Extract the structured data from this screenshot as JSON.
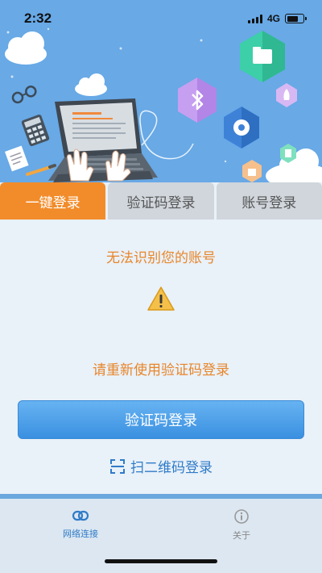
{
  "status": {
    "time": "2:32",
    "network": "4G"
  },
  "tabs": [
    {
      "label": "一键登录",
      "active": true
    },
    {
      "label": "验证码登录",
      "active": false
    },
    {
      "label": "账号登录",
      "active": false
    }
  ],
  "main": {
    "message_primary": "无法识别您的账号",
    "message_secondary": "请重新使用验证码登录",
    "primary_button": "验证码登录",
    "qr_link": "扫二维码登录",
    "warning_icon": "warning-icon"
  },
  "bottom_nav": [
    {
      "label": "网络连接",
      "icon": "link-icon",
      "active": true
    },
    {
      "label": "关于",
      "icon": "info-icon",
      "active": false
    }
  ],
  "colors": {
    "accent": "#f28c2a",
    "primary_blue": "#3a90e0",
    "banner": "#68a9e6"
  }
}
